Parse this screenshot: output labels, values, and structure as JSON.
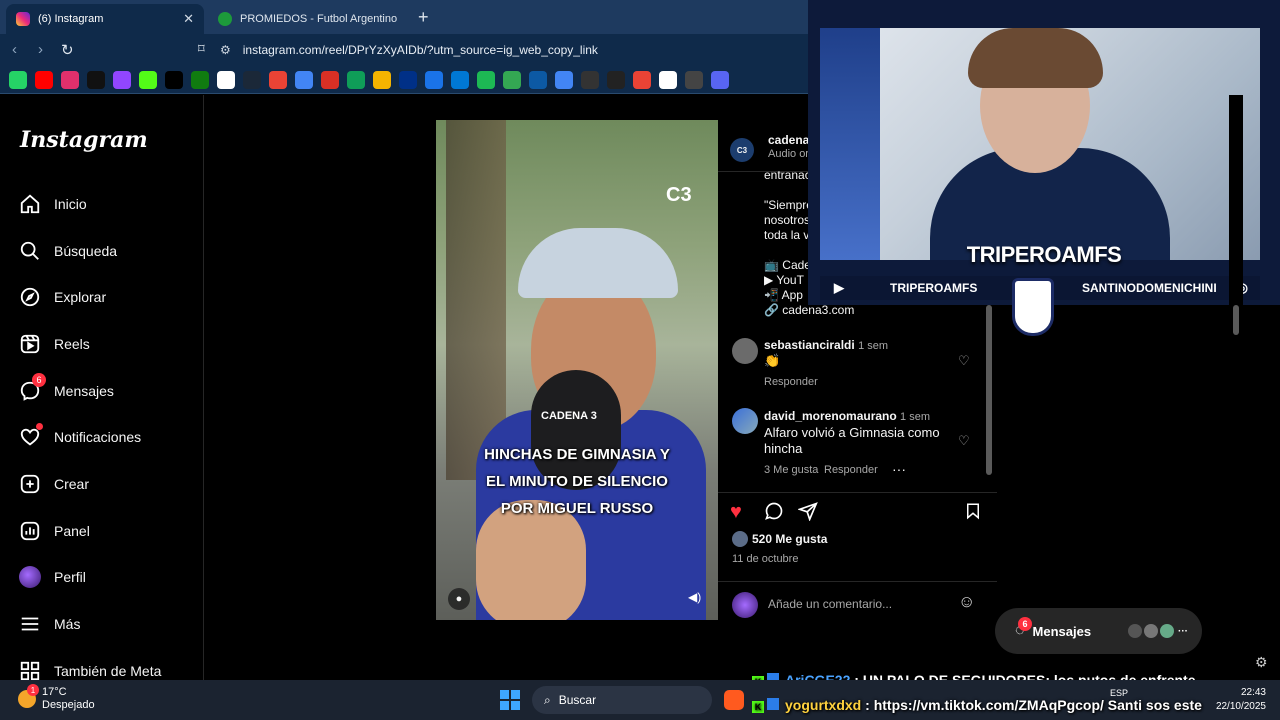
{
  "browser": {
    "tabs": [
      {
        "title": "(6) Instagram",
        "active": true
      },
      {
        "title": "PROMIEDOS - Futbol Argentino - Fix",
        "active": false
      }
    ],
    "url": "instagram.com/reel/DPrYzXyAIDb/?utm_source=ig_web_copy_link",
    "bookmark_icons": [
      "whatsapp-icon",
      "youtube-icon",
      "instagram-icon",
      "tiktok-icon",
      "twitch-icon",
      "kick-icon",
      "x-icon",
      "xbox-icon",
      "google-icon",
      "steam-icon",
      "bookmark-icon",
      "docs-icon",
      "gmail-icon",
      "sheets-icon",
      "pencil-icon",
      "paypal-icon",
      "calendar-icon",
      "microsoft-icon",
      "spotify-icon",
      "download-icon",
      "edge-icon",
      "chrome-icon",
      "game-icon",
      "hub-icon",
      "photos-icon",
      "google-icon",
      "news-icon",
      "discord-icon"
    ]
  },
  "sidebar": {
    "logo": "Instagram",
    "items": [
      {
        "label": "Inicio",
        "icon": "home-icon"
      },
      {
        "label": "Búsqueda",
        "icon": "search-icon"
      },
      {
        "label": "Explorar",
        "icon": "compass-icon"
      },
      {
        "label": "Reels",
        "icon": "reels-icon"
      },
      {
        "label": "Mensajes",
        "icon": "messenger-icon",
        "badge": "6"
      },
      {
        "label": "Notificaciones",
        "icon": "heart-icon"
      },
      {
        "label": "Crear",
        "icon": "plus-icon"
      },
      {
        "label": "Panel",
        "icon": "chart-icon"
      },
      {
        "label": "Perfil",
        "icon": "avatar-icon"
      },
      {
        "label": "Más",
        "icon": "menu-icon"
      },
      {
        "label": "También de Meta",
        "icon": "meta-icon"
      }
    ]
  },
  "reel": {
    "watermark": "C3",
    "mic_label": "CADENA 3",
    "caption_lines": [
      "HINCHAS DE GIMNASIA Y",
      "EL MINUTO DE SILENCIO",
      "POR MIGUEL RUSSO"
    ]
  },
  "post": {
    "author": "cadena3",
    "subtitle": "Audio or",
    "avatar_text": "C3",
    "desc_lines": [
      "entranac",
      "",
      "\"Siempre",
      "nosotros",
      "toda la v",
      "",
      "📺 Cade",
      "▶ YouT",
      "📲 App",
      "🔗 cadena3.com"
    ],
    "comments": [
      {
        "user": "sebastianciraldi",
        "time": "1 sem",
        "text": "👏",
        "reply": "Responder",
        "likes": ""
      },
      {
        "user": "david_morenomaurano",
        "time": "1 sem",
        "text": "Alfaro volvió a Gimnasia como hincha",
        "reply": "Responder",
        "likes": "3 Me gusta"
      }
    ],
    "likes": "520 Me gusta",
    "date": "11 de octubre",
    "comment_placeholder": "Añade un comentario..."
  },
  "stream": {
    "name": "TRIPEROAMFS",
    "bar_left": "TRIPEROAMFS",
    "bar_right": "SANTINODOMENICHINI"
  },
  "messages_pill": {
    "label": "Mensajes",
    "badge": "6",
    "more": "···"
  },
  "chat": [
    {
      "user": "AriCGE22",
      "sep": ":",
      "msg": "UN PALO DE SEGUIDORES; los putos de enfrente",
      "color": "#4aa3ff"
    },
    {
      "user": "yogurtxdxd",
      "sep": ":",
      "msg": "https://vm.tiktok.com/ZMAqPgcop/ Santi sos este",
      "color": "#ffd23f"
    }
  ],
  "taskbar": {
    "weather_temp": "17°C",
    "weather_desc": "Despejado",
    "weather_badge": "1",
    "search_label": "Buscar",
    "lang": "ESP",
    "time": "22:43",
    "date": "22/10/2025"
  },
  "colors": {
    "accent": "#ff3040",
    "chrome": "#0f2a4a",
    "tabbar": "#1e3a5f"
  }
}
